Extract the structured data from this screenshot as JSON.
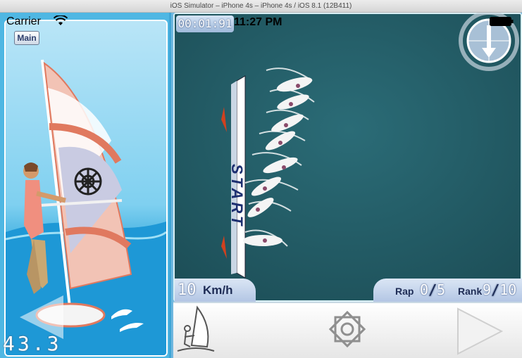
{
  "window": {
    "title": "iOS Simulator – iPhone 4s – iPhone 4s / iOS 8.1 (12B411)"
  },
  "status_bar": {
    "carrier": "Carrier",
    "time": "11:27 PM"
  },
  "left_panel": {
    "main_button": "Main",
    "speed_readout": "43.3"
  },
  "hud": {
    "timer": "00:01:91",
    "speed_value": "10",
    "speed_unit": "Km/h",
    "lap_label": "Rap",
    "lap_current": "0",
    "lap_total": "5",
    "lap_separator": "/",
    "rank_label": "Rank",
    "rank_current": "9",
    "rank_total": "10",
    "rank_separator": "/",
    "start_banner": "START"
  },
  "colors": {
    "sea": "#245d67",
    "sky": "#4fb7e3",
    "sail": "#f08f7f",
    "hud": "#b3c6e4"
  },
  "icons": [
    "wifi-icon",
    "battery-icon",
    "compass-icon",
    "back-arrow-icon",
    "windsurfer-icon",
    "emblem-icon",
    "play-icon"
  ]
}
